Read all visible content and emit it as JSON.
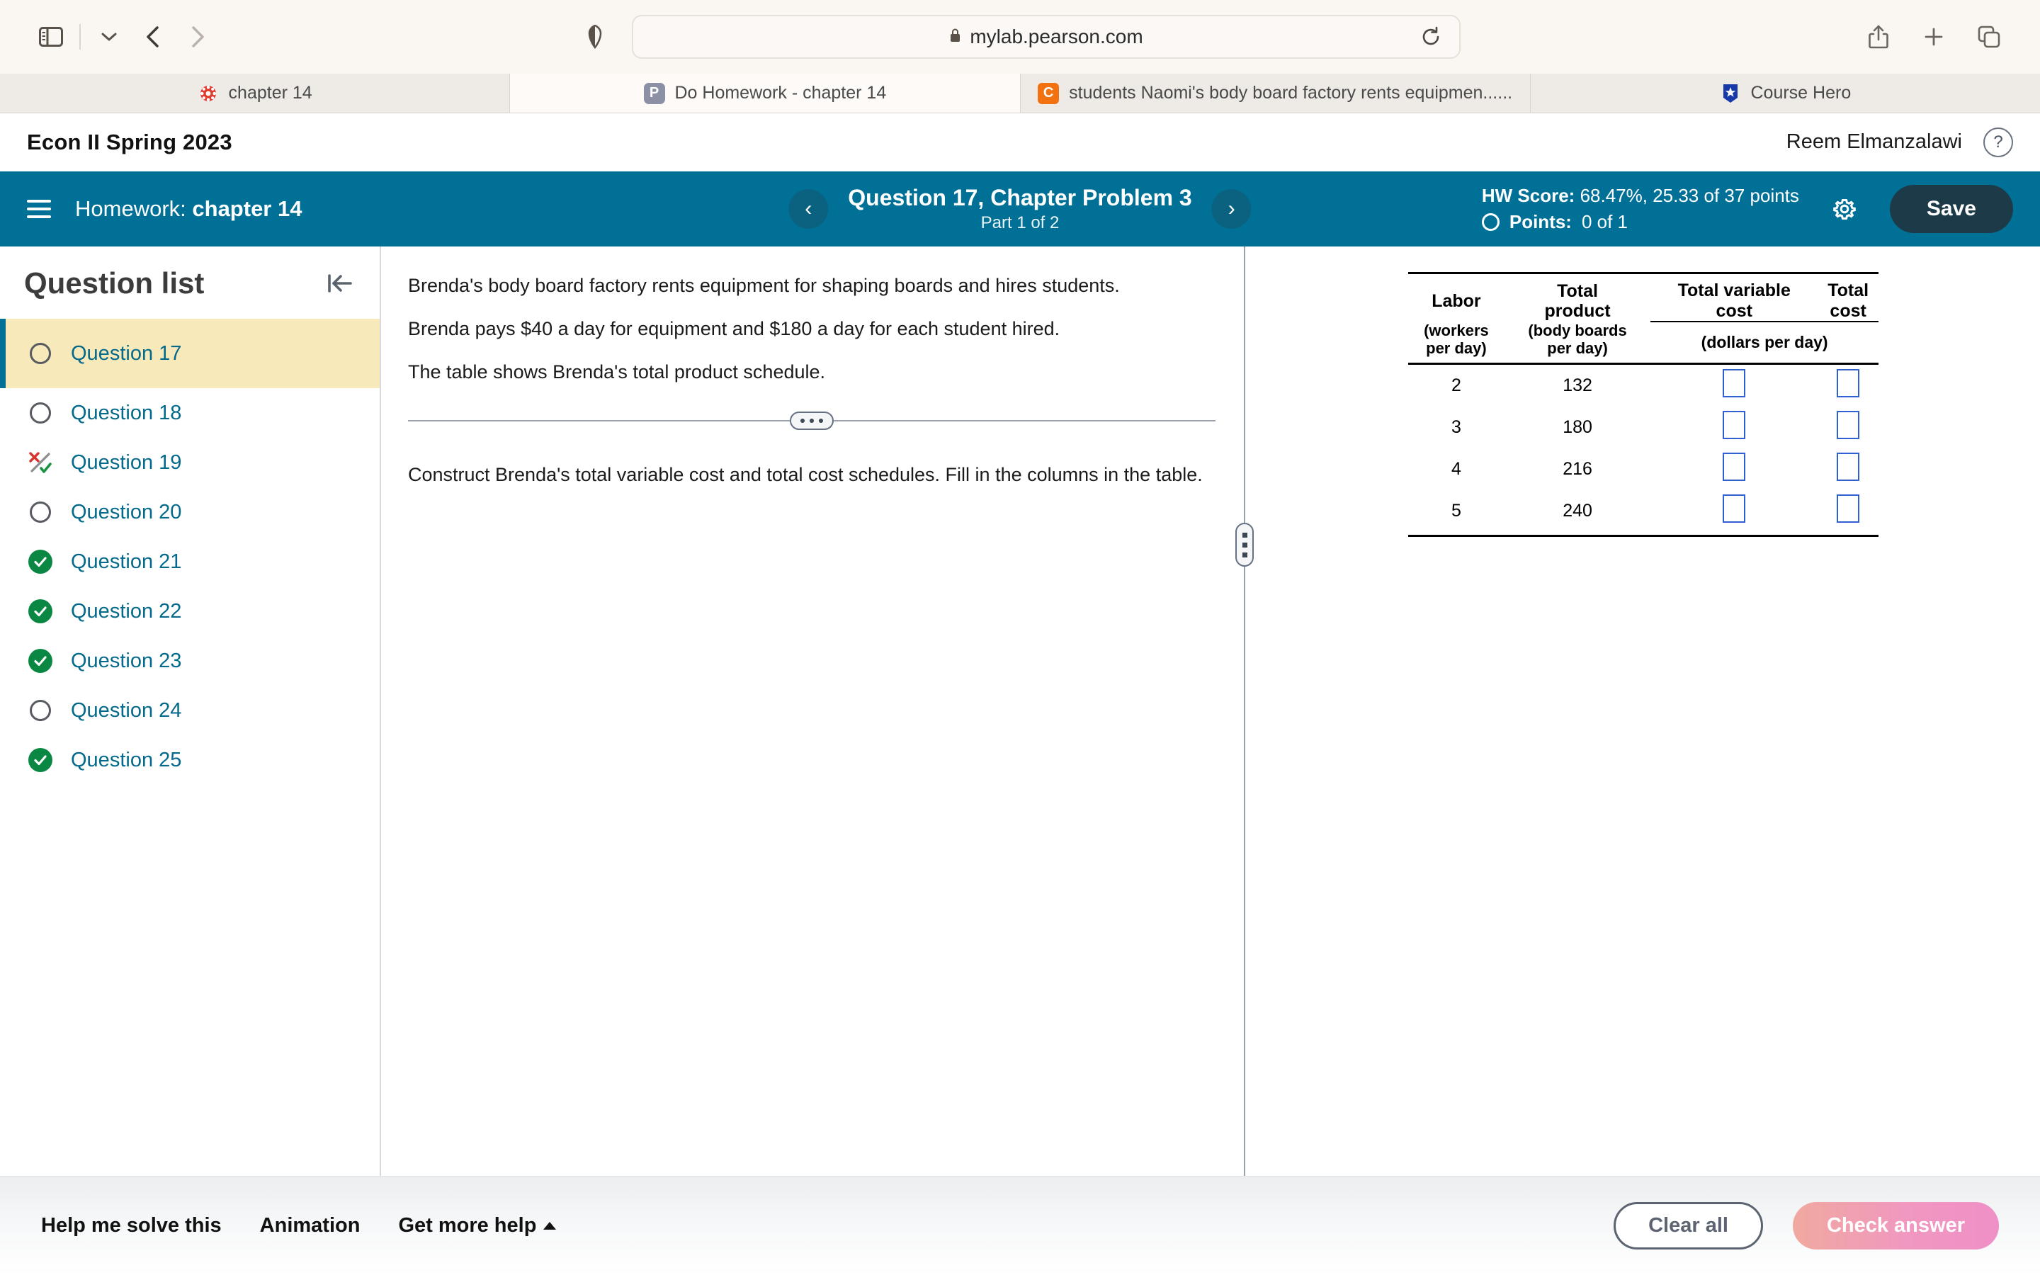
{
  "browser": {
    "url": "mylab.pearson.com",
    "icons": {
      "sidebar_toggle": "sidebar-icon",
      "sidebar_dropdown": "chevron-down-icon",
      "back": "chevron-left-icon",
      "forward": "chevron-right-icon",
      "shield": "shield-icon",
      "lock": "lock-icon",
      "reload": "reload-icon",
      "share": "share-icon",
      "new_tab": "plus-icon",
      "tab_overview": "tab-overview-icon"
    },
    "tabs": [
      {
        "label": "chapter 14",
        "favicon": "canvas-icon",
        "favicon_letter": "",
        "active": false
      },
      {
        "label": "Do Homework - chapter 14",
        "favicon": "pearson-icon",
        "favicon_letter": "P",
        "active": true
      },
      {
        "label": "students Naomi's body board factory rents equipmen......",
        "favicon": "chegg-icon",
        "favicon_letter": "C",
        "active": false
      },
      {
        "label": "Course Hero",
        "favicon": "coursehero-icon",
        "favicon_letter": "",
        "active": false
      }
    ]
  },
  "course_header": {
    "course_title": "Econ II Spring 2023",
    "user_name": "Reem Elmanzalawi",
    "help_label": "?"
  },
  "teal_bar": {
    "homework_prefix": "Homework:",
    "homework_name": "chapter 14",
    "prev_arrow": "‹",
    "next_arrow": "›",
    "question_title": "Question 17, Chapter Problem 3",
    "part_label": "Part 1 of 2",
    "hw_score_label": "HW Score:",
    "hw_score_value": "68.47%, 25.33 of 37 points",
    "points_label": "Points:",
    "points_value": "0 of 1",
    "save_label": "Save",
    "accent_color": "#007096",
    "save_bg": "#1c3a47"
  },
  "sidebar": {
    "title": "Question list",
    "collapse_icon": "collapse-left-icon",
    "items": [
      {
        "label": "Question 17",
        "status": "open",
        "selected": true
      },
      {
        "label": "Question 18",
        "status": "open",
        "selected": false
      },
      {
        "label": "Question 19",
        "status": "partial",
        "selected": false
      },
      {
        "label": "Question 20",
        "status": "open",
        "selected": false
      },
      {
        "label": "Question 21",
        "status": "correct",
        "selected": false
      },
      {
        "label": "Question 22",
        "status": "correct",
        "selected": false
      },
      {
        "label": "Question 23",
        "status": "correct",
        "selected": false
      },
      {
        "label": "Question 24",
        "status": "open",
        "selected": false
      },
      {
        "label": "Question 25",
        "status": "correct",
        "selected": false
      }
    ],
    "highlight_color": "#f7e9b9",
    "link_color": "#046A8C",
    "correct_color": "#0a8743"
  },
  "problem": {
    "lines": [
      "Brenda's body board factory rents equipment for shaping boards and hires students.",
      "Brenda pays $40 a day for equipment and $180 a day for each student hired.",
      "The table shows Brenda's total product schedule."
    ],
    "task": "Construct Brenda's total variable cost and total cost schedules. Fill in the columns in the table."
  },
  "chart_data": {
    "type": "table",
    "title": "Brenda's total product schedule",
    "columns": [
      {
        "main": "Labor",
        "sub": "(workers\nper day)",
        "unit": ""
      },
      {
        "main": "Total\nproduct",
        "sub": "(body boards\nper day)",
        "unit": ""
      },
      {
        "main": "Total variable\ncost",
        "sub": "",
        "unit": "(dollars per day)"
      },
      {
        "main": "Total\ncost",
        "sub": "",
        "unit": "(dollars per day)"
      }
    ],
    "header_labor": "Labor",
    "header_labor_sub1": "(workers",
    "header_labor_sub2": "per day)",
    "header_product1": "Total",
    "header_product2": "product",
    "header_product_sub1": "(body boards",
    "header_product_sub2": "per day)",
    "header_tvc1": "Total variable",
    "header_tvc2": "cost",
    "header_tc1": "Total",
    "header_tc2": "cost",
    "header_units": "(dollars per day)",
    "labor": [
      2,
      3,
      4,
      5
    ],
    "total_product": [
      132,
      180,
      216,
      240
    ],
    "total_variable_cost": [
      "",
      "",
      "",
      ""
    ],
    "total_cost": [
      "",
      "",
      "",
      ""
    ],
    "input_box_color": "#2f5fd0"
  },
  "bottom_bar": {
    "help_solve": "Help me solve this",
    "animation": "Animation",
    "get_more_help": "Get more help",
    "clear_all": "Clear all",
    "check_answer": "Check answer"
  }
}
